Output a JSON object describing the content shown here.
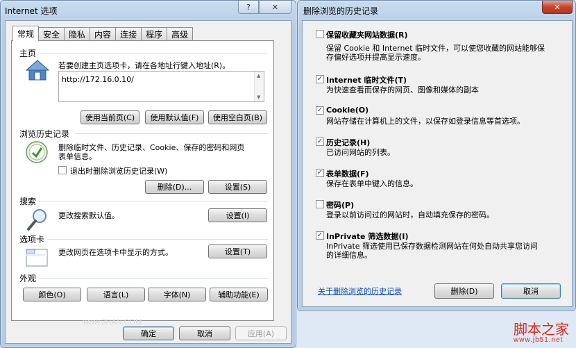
{
  "left_dialog": {
    "title": "Internet 选项",
    "help_btn": "?",
    "close_btn": "✕",
    "tabs": [
      "常规",
      "安全",
      "隐私",
      "内容",
      "连接",
      "程序",
      "高级"
    ],
    "homepage": {
      "section_title": "主页",
      "description": "若要创建主页选项卡，请在各地址行键入地址(R)。",
      "url": "http://172.16.0.10/",
      "use_current": "使用当前页(C)",
      "use_default": "使用默认值(F)",
      "use_blank": "使用空白页(B)"
    },
    "history": {
      "section_title": "浏览历史记录",
      "description_line1": "删除临时文件、历史记录、Cookie、保存的密码和网页",
      "description_line2": "表单信息。",
      "delete_on_exit": "退出时删除浏览历史记录(W)",
      "delete_btn": "删除(D)...",
      "settings_btn": "设置(S)"
    },
    "search": {
      "section_title": "搜索",
      "description": "更改搜索默认值。",
      "settings_btn": "设置(I)"
    },
    "tabs_section": {
      "section_title": "选项卡",
      "description": "更改网页在选项卡中显示的方式。",
      "settings_btn": "设置(T)"
    },
    "appearance": {
      "section_title": "外观",
      "colors_btn": "颜色(O)",
      "languages_btn": "语言(L)",
      "fonts_btn": "字体(N)",
      "accessibility_btn": "辅助功能(E)"
    },
    "ok_btn": "确定",
    "cancel_btn": "取消",
    "apply_btn": "应用(A)",
    "watermark": "www.3HAN.COM"
  },
  "right_dialog": {
    "title": "删除浏览的历史记录",
    "close_btn": "✕",
    "options": [
      {
        "label": "保留收藏夹网站数据(R)",
        "desc1": "保留 Cookie 和 Internet 临时文件，可以使您收藏的网站能够保",
        "desc2": "存偏好选项并提高显示速度。",
        "checked": false
      },
      {
        "label": "Internet 临时文件(T)",
        "desc1": "为快速查看而保存的网页、图像和媒体的副本",
        "desc2": "",
        "checked": true
      },
      {
        "label": "Cookie(O)",
        "desc1": "网站存储在计算机上的文件，以保存如登录信息等首选项。",
        "desc2": "",
        "checked": true
      },
      {
        "label": "历史记录(H)",
        "desc1": "已访问网站的列表。",
        "desc2": "",
        "checked": true
      },
      {
        "label": "表单数据(F)",
        "desc1": "保存在表单中键入的信息。",
        "desc2": "",
        "checked": true
      },
      {
        "label": "密码(P)",
        "desc1": "登录以前访问过的网站时，自动填充保存的密码。",
        "desc2": "",
        "checked": false
      },
      {
        "label": "InPrivate 筛选数据(I)",
        "desc1": "InPrivate 筛选使用已保存数据检测网站在何处自动共享您访问",
        "desc2": "的详细信息。",
        "checked": true
      }
    ],
    "about_link": "关于删除浏览的历史记录",
    "delete_btn": "删除(D)",
    "cancel_btn": "取消"
  },
  "site_watermark": {
    "name": "脚本之家",
    "url": "www.jb51.net"
  },
  "colors": {
    "watermark_red": "#d42a1f",
    "link_blue": "#0b4db3",
    "check_blue": "#1e3f6e"
  }
}
